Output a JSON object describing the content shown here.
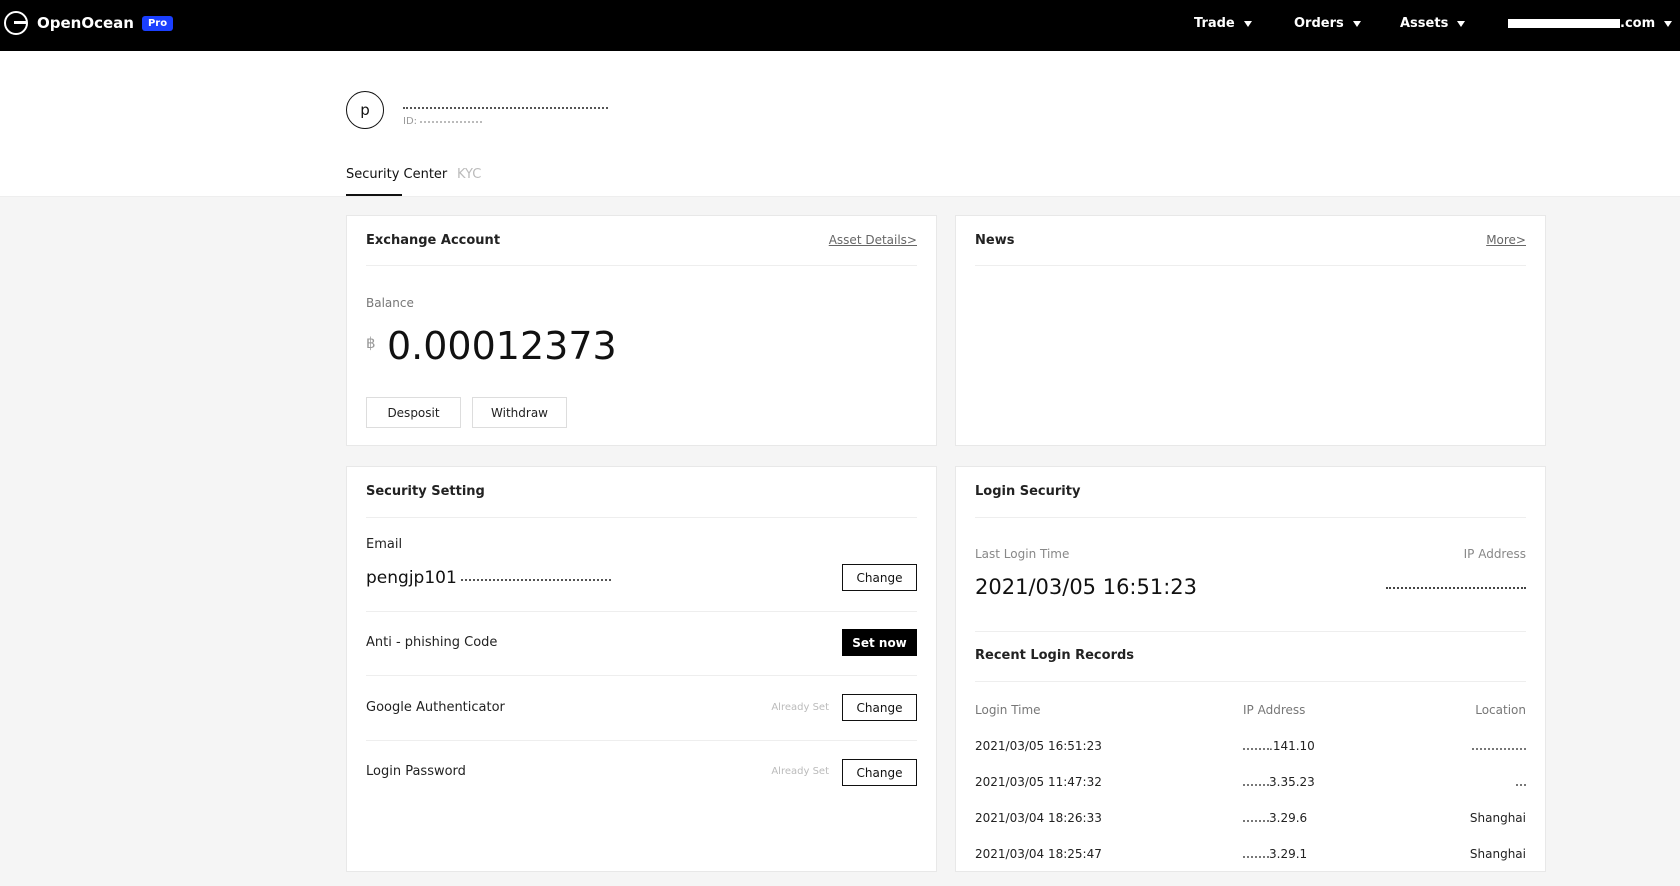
{
  "nav": {
    "brand": "OpenOcean",
    "badge": "Pro",
    "items": [
      {
        "label": "Trade"
      },
      {
        "label": "Orders"
      },
      {
        "label": "Assets"
      }
    ],
    "account_suffix": ".com"
  },
  "profile": {
    "avatar_letter": "p",
    "id_label": "ID:"
  },
  "tabs": [
    {
      "label": "Security Center",
      "active": true
    },
    {
      "label": "KYC",
      "active": false
    }
  ],
  "exchange": {
    "title": "Exchange Account",
    "link": "Asset Details>",
    "balance_label": "Balance",
    "currency_symbol": "฿",
    "balance": "0.00012373",
    "deposit_label": "Desposit",
    "withdraw_label": "Withdraw"
  },
  "news": {
    "title": "News",
    "link": "More>"
  },
  "security": {
    "title": "Security Setting",
    "email_label": "Email",
    "email_value": "pengjp101",
    "change_label": "Change",
    "antiphishing_label": "Anti - phishing Code",
    "set_now_label": "Set now",
    "google_label": "Google Authenticator",
    "already_set": "Already Set",
    "password_label": "Login Password"
  },
  "login": {
    "title": "Login Security",
    "last_login_label": "Last Login Time",
    "ip_label": "IP Address",
    "last_login_time": "2021/03/05 16:51:23",
    "recent_title": "Recent Login Records",
    "col_time": "Login Time",
    "col_ip": "IP Address",
    "col_location": "Location",
    "records": [
      {
        "time": "2021/03/05 16:51:23",
        "ip": ".141.10"
      },
      {
        "time": "2021/03/05 11:47:32",
        "ip": "3.35.23"
      },
      {
        "time": "2021/03/04 18:26:33",
        "ip": "3.29.6",
        "location": "Shanghai"
      },
      {
        "time": "2021/03/04 18:25:47",
        "ip": "3.29.1",
        "location": "Shanghai"
      }
    ]
  }
}
